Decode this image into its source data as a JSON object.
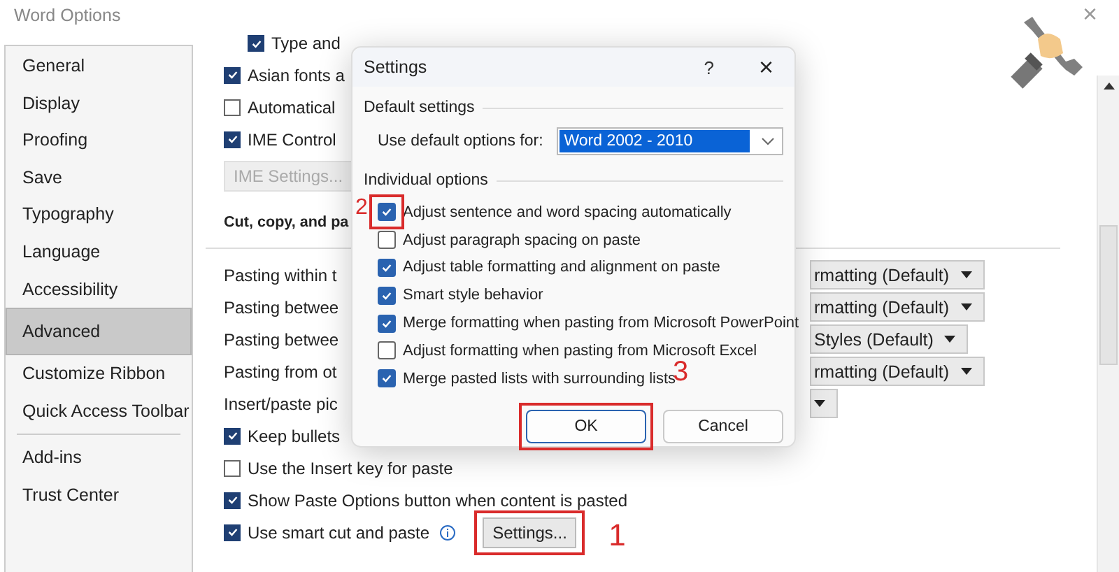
{
  "window": {
    "title": "Word Options",
    "close": "×"
  },
  "sidebar": {
    "items": [
      {
        "label": "General",
        "selected": false
      },
      {
        "label": "Display",
        "selected": false
      },
      {
        "label": "Proofing",
        "selected": false
      },
      {
        "label": "Save",
        "selected": false
      },
      {
        "label": "Typography",
        "selected": false
      },
      {
        "label": "Language",
        "selected": false
      },
      {
        "label": "Accessibility",
        "selected": false
      },
      {
        "label": "Advanced",
        "selected": true
      },
      {
        "label": "Customize Ribbon",
        "selected": false
      },
      {
        "label": "Quick Access Toolbar",
        "selected": false
      },
      {
        "label": "Add-ins",
        "selected": false,
        "divider_before": true
      },
      {
        "label": "Trust Center",
        "selected": false
      }
    ]
  },
  "options": [
    {
      "kind": "subcheckbox",
      "label": "Type and",
      "checked": true
    },
    {
      "kind": "checkbox",
      "label": "Asian fonts a",
      "checked": true
    },
    {
      "kind": "checkbox",
      "label": "Automatical",
      "checked": false
    },
    {
      "kind": "checkbox",
      "label": "IME Control",
      "checked": true
    },
    {
      "kind": "button",
      "label": "IME Settings...",
      "disabled": true
    },
    {
      "kind": "heading",
      "label": "Cut, copy, and pa"
    },
    {
      "kind": "dropdown",
      "label": "Pasting within t",
      "value": "rmatting (Default)"
    },
    {
      "kind": "dropdown",
      "label": "Pasting betwee",
      "value": "rmatting (Default)"
    },
    {
      "kind": "dropdown",
      "label": "Pasting betwee",
      "value": "Styles (Default)"
    },
    {
      "kind": "dropdown",
      "label": "Pasting from ot",
      "value": "rmatting (Default)"
    },
    {
      "kind": "dropdown",
      "label": "Insert/paste pic"
    },
    {
      "kind": "checkbox",
      "label": "Keep bullets",
      "checked": true
    },
    {
      "kind": "checkbox",
      "label": "Use the Insert key for paste",
      "checked": false
    },
    {
      "kind": "checkbox",
      "label": "Show Paste Options button when content is pasted",
      "checked": true
    },
    {
      "kind": "checkbox_button",
      "label": "Use smart cut and paste",
      "checked": true,
      "info": true,
      "button": "Settings...",
      "highlighted": true,
      "callout": "1"
    }
  ],
  "dialog": {
    "title": "Settings",
    "help": "?",
    "close": "×",
    "default_group": "Default settings",
    "default_label": "Use default options for:",
    "default_value": "Word 2002 - 2010",
    "options_group": "Individual options",
    "options": [
      {
        "label": "Adjust sentence and word spacing automatically",
        "checked": true,
        "highlighted": true,
        "callout": "2"
      },
      {
        "label": "Adjust paragraph spacing on paste",
        "checked": false
      },
      {
        "label": "Adjust table formatting and alignment on paste",
        "checked": true
      },
      {
        "label": "Smart style behavior",
        "checked": true
      },
      {
        "label": "Merge formatting when pasting from Microsoft PowerPoint",
        "checked": true
      },
      {
        "label": "Adjust formatting when pasting from Microsoft Excel",
        "checked": false
      },
      {
        "label": "Merge pasted lists with surrounding lists",
        "checked": true
      }
    ],
    "buttons": [
      {
        "label": "OK",
        "highlighted": true,
        "callout": "3"
      },
      {
        "label": "Cancel",
        "highlighted": false
      }
    ]
  }
}
